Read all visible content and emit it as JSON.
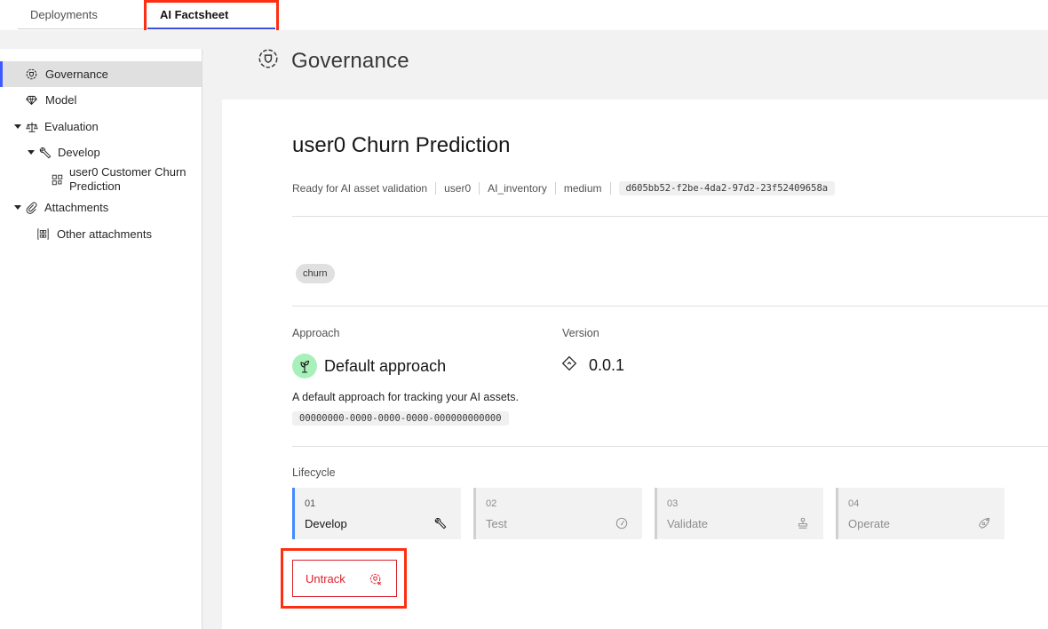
{
  "tabs": [
    {
      "label": "Deployments",
      "active": false
    },
    {
      "label": "AI Factsheet",
      "active": true
    }
  ],
  "sidebar": {
    "items": [
      {
        "label": "Governance",
        "icon": "governance-icon",
        "active": true
      },
      {
        "label": "Model",
        "icon": "diamond-model-icon",
        "active": false
      },
      {
        "label": "Evaluation",
        "icon": "scales-icon",
        "expanded": true
      },
      {
        "label": "Develop",
        "icon": "wrench-icon",
        "expanded": true
      },
      {
        "label": "user0 Customer Churn Prediction",
        "line1": "user0 Customer Churn",
        "line2": "Prediction",
        "icon": "model-grid-icon"
      },
      {
        "label": "Attachments",
        "icon": "paperclip-icon",
        "expanded": true
      },
      {
        "label": "Other attachments",
        "icon": "attachments-grid-icon"
      }
    ]
  },
  "page": {
    "title": "Governance",
    "icon": "governance-icon"
  },
  "asset": {
    "title": "user0 Churn Prediction",
    "meta": {
      "status": "Ready for AI asset validation",
      "owner": "user0",
      "inventory": "AI_inventory",
      "risk": "medium",
      "id": "d605bb52-f2be-4da2-97d2-23f52409658a"
    },
    "tags": [
      "churn"
    ]
  },
  "approach": {
    "label": "Approach",
    "name": "Default approach",
    "description": "A default approach for tracking your AI assets.",
    "id": "00000000-0000-0000-0000-000000000000",
    "icon": "sprout-icon",
    "icon_bg": "#a7f0ba"
  },
  "version": {
    "label": "Version",
    "value": "0.0.1",
    "icon": "version-diamond-icon"
  },
  "lifecycle": {
    "label": "Lifecycle",
    "stages": [
      {
        "num": "01",
        "name": "Develop",
        "icon": "wrench-icon",
        "active": true
      },
      {
        "num": "02",
        "name": "Test",
        "icon": "gauge-icon",
        "active": false
      },
      {
        "num": "03",
        "name": "Validate",
        "icon": "stamp-icon",
        "active": false
      },
      {
        "num": "04",
        "name": "Operate",
        "icon": "rocket-icon",
        "active": false
      }
    ]
  },
  "actions": {
    "untrack_label": "Untrack",
    "untrack_color": "#da1e28"
  },
  "colors": {
    "accent": "#3d5afe",
    "active_stage": "#4589ff",
    "highlight_box": "#ff2e12"
  }
}
